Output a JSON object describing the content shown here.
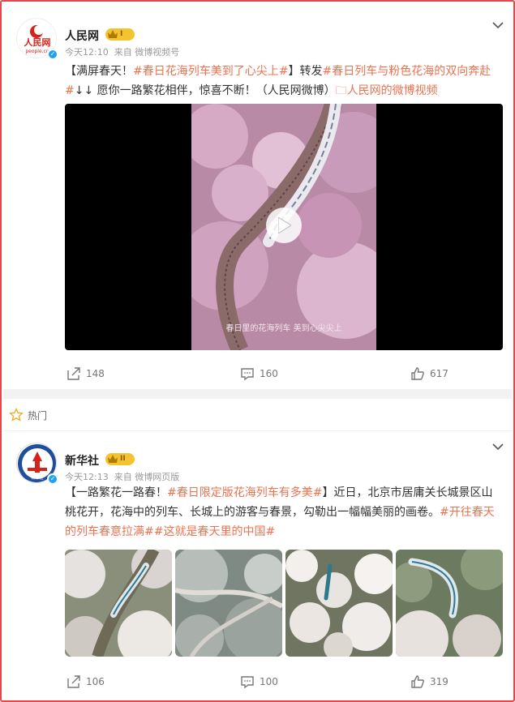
{
  "hot_label": "热门",
  "posts": [
    {
      "author": "人民网",
      "level": "I",
      "time": "今天12:10",
      "source": "来自 微博视频号",
      "text_parts": [
        {
          "t": "【满屏春天！",
          "tag": false
        },
        {
          "t": "#春日花海列车美到了心尖上#",
          "tag": true
        },
        {
          "t": "】转发",
          "tag": false
        },
        {
          "t": "#春日列车与粉色花海的双向奔赴#",
          "tag": true
        },
        {
          "t": "↓↓ 愿你一路繁花相伴，惊喜不断！（人民网微博）",
          "tag": false
        },
        {
          "t": "🗀人民网的微博视频",
          "tag": true
        }
      ],
      "video_caption": "春日里的花海列车 美到心尖尖上",
      "actions": {
        "share": "148",
        "comment": "160",
        "like": "617"
      },
      "colors": {
        "accent": "#eb7350",
        "blossom": "#d8a7c4"
      }
    },
    {
      "author": "新华社",
      "level": "II",
      "time": "今天12:13",
      "source": "来自 微博网页版",
      "text_parts": [
        {
          "t": "【一路繁花一路春！",
          "tag": false
        },
        {
          "t": "#春日限定版花海列车有多美#",
          "tag": true
        },
        {
          "t": "】近日，北京市居庸关长城景区山桃花开，花海中的列车、长城上的游客与春景，勾勒出一幅幅美丽的画卷。",
          "tag": false
        },
        {
          "t": "#开往春天的列车春意拉满#",
          "tag": true
        },
        {
          "t": "#这就是春天里的中国#",
          "tag": true
        }
      ],
      "actions": {
        "share": "106",
        "comment": "100",
        "like": "319"
      }
    }
  ]
}
